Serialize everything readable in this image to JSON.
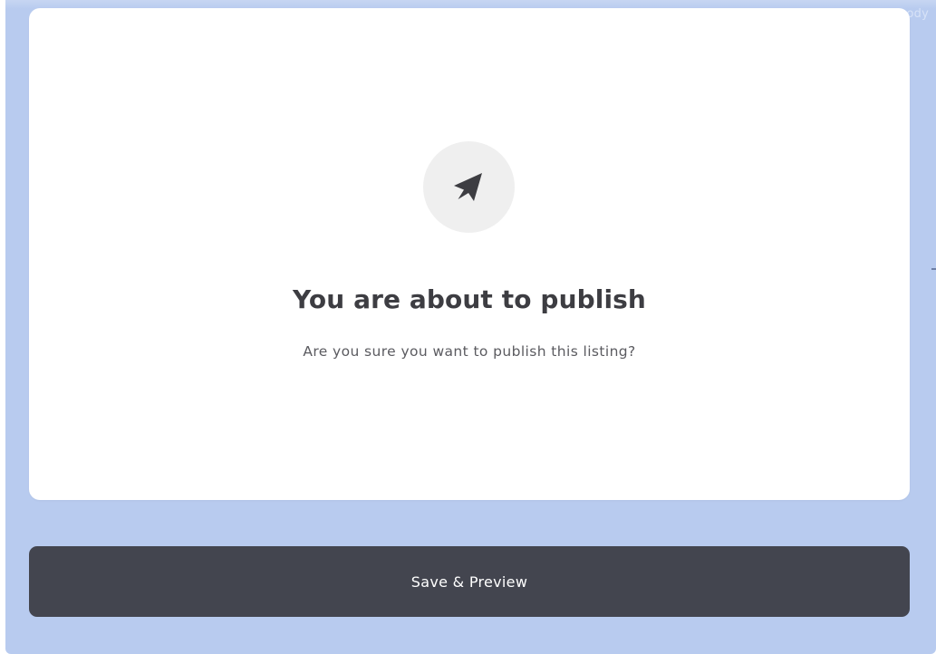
{
  "app": {
    "corner_label": "Moody"
  },
  "dialog": {
    "icon": "paper-plane-icon",
    "title": "You are about to publish",
    "message": "Are you sure you want to publish this listing?"
  },
  "actions": {
    "save_preview_label": "Save & Preview"
  },
  "colors": {
    "background": "#b8cbef",
    "card": "#ffffff",
    "icon_circle": "#efefef",
    "button": "#43454f",
    "title_text": "#3d3d42"
  }
}
